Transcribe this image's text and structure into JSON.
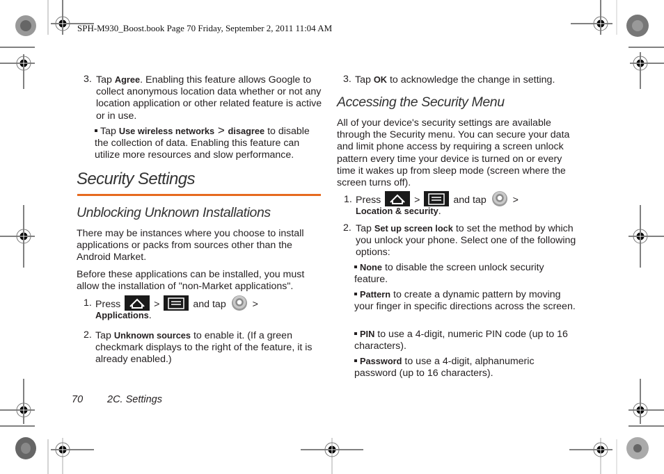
{
  "slug": "SPH-M930_Boost.book  Page 70  Friday, September 2, 2011  11:04 AM",
  "left": {
    "step3": {
      "num": "3.",
      "pre": "Tap ",
      "bold": "Agree",
      "post": ". Enabling this feature allows Google to collect anonymous location data whether or not any location application or other related feature is active or in use."
    },
    "step3_bullet": {
      "pre": "Tap ",
      "bold1": "Use wireless networks",
      "sep": " > ",
      "bold2": "disagree",
      "post": " to disable the collection of data. Enabling this feature can utilize more resources and slow performance."
    },
    "section_title": "Security Settings",
    "subsection_title": "Unblocking Unknown Installations",
    "para1": "There may be instances where you choose to install applications or packs from sources other than the Android Market.",
    "para2": "Before these applications can be installed, you must allow the installation of \"non-Market applications\".",
    "step1": {
      "num": "1.",
      "pre": "Press",
      "sep1": ">",
      "mid": "and tap",
      "sep2": ">",
      "bold": "Applications",
      "post": "."
    },
    "step2": {
      "num": "2.",
      "pre": "Tap ",
      "bold": "Unknown sources",
      "post": " to enable it. (If a green checkmark displays to the right of the feature, it is already enabled.)"
    }
  },
  "right": {
    "step3": {
      "num": "3.",
      "pre": "Tap ",
      "bold": "OK",
      "post": " to acknowledge the change in setting."
    },
    "subsection_title": "Accessing the Security Menu",
    "para1": "All of your device's security settings are available through the Security menu. You can secure your data and limit phone access by requiring a screen unlock pattern every time your device is turned on or every time it wakes up from sleep mode (screen where the screen turns off).",
    "step1": {
      "num": "1.",
      "pre": "Press",
      "sep1": ">",
      "mid": "and tap",
      "sep2": ">",
      "bold": "Location & security",
      "post": "."
    },
    "step2": {
      "num": "2.",
      "pre": "Tap ",
      "bold": "Set up screen lock",
      "post": " to set the method by which you unlock your phone. Select one of the following options:"
    },
    "options": [
      {
        "bold": "None",
        "text": " to disable the screen unlock security feature."
      },
      {
        "bold": "Pattern",
        "text": " to create a dynamic pattern by moving your finger in specific directions across the screen."
      },
      {
        "bold": "PIN",
        "text": " to use a 4-digit, numeric PIN code (up to 16 characters)."
      },
      {
        "bold": "Password",
        "text": " to use a 4-digit, alphanumeric password (up to 16 characters)."
      }
    ]
  },
  "footer": {
    "page_number": "70",
    "section": "2C. Settings"
  },
  "colors": {
    "accent_rule": "#e66a1f"
  }
}
